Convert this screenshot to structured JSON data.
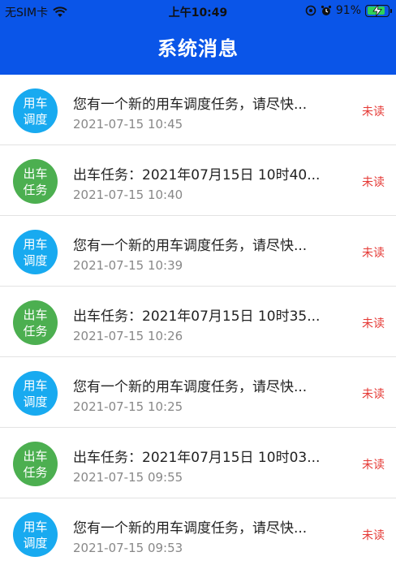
{
  "status_bar": {
    "carrier": "无SIM卡",
    "time": "上午10:49",
    "battery_percent_label": "91%",
    "battery_level": 0.91
  },
  "header": {
    "title": "系统消息"
  },
  "messages": [
    {
      "icon_text": "用车调度",
      "icon_color": "#18aaf0",
      "title": "您有一个新的用车调度任务，请尽快...",
      "time": "2021-07-15 10:45",
      "status": "未读"
    },
    {
      "icon_text": "出车任务",
      "icon_color": "#4caf50",
      "title": "出车任务：2021年07月15日 10时40...",
      "time": "2021-07-15 10:40",
      "status": "未读"
    },
    {
      "icon_text": "用车调度",
      "icon_color": "#18aaf0",
      "title": "您有一个新的用车调度任务，请尽快...",
      "time": "2021-07-15 10:39",
      "status": "未读"
    },
    {
      "icon_text": "出车任务",
      "icon_color": "#4caf50",
      "title": "出车任务：2021年07月15日 10时35...",
      "time": "2021-07-15 10:26",
      "status": "未读"
    },
    {
      "icon_text": "用车调度",
      "icon_color": "#18aaf0",
      "title": "您有一个新的用车调度任务，请尽快...",
      "time": "2021-07-15 10:25",
      "status": "未读"
    },
    {
      "icon_text": "出车任务",
      "icon_color": "#4caf50",
      "title": "出车任务：2021年07月15日 10时03...",
      "time": "2021-07-15 09:55",
      "status": "未读"
    },
    {
      "icon_text": "用车调度",
      "icon_color": "#18aaf0",
      "title": "您有一个新的用车调度任务，请尽快...",
      "time": "2021-07-15 09:53",
      "status": "未读"
    }
  ]
}
